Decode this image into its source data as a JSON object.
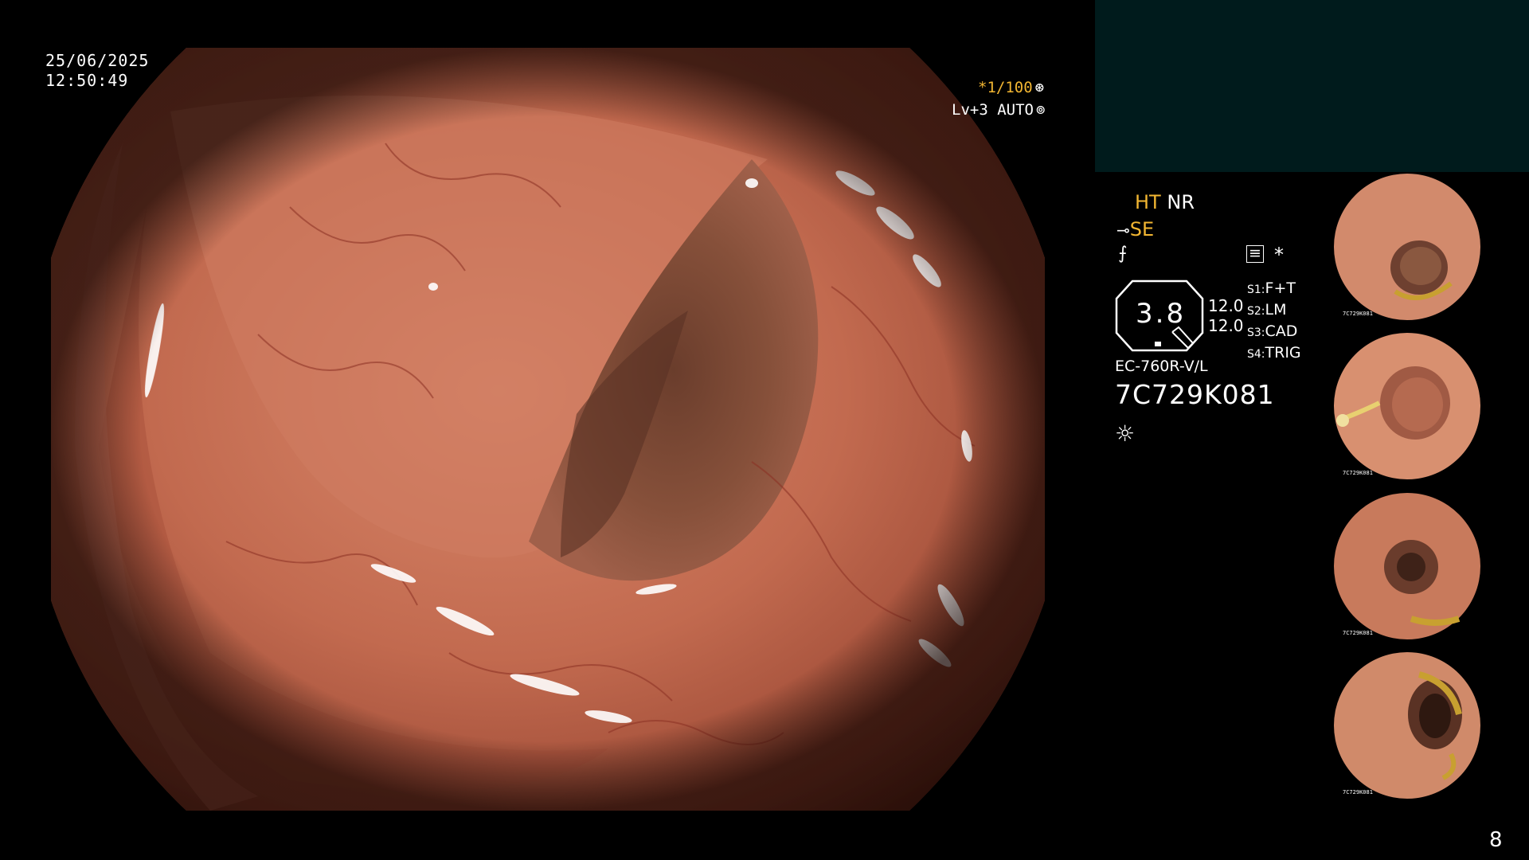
{
  "overlay": {
    "date": "25/06/2025",
    "time": "12:50:49",
    "shutter": "*1/100",
    "shutter_icon": "aperture-icon",
    "level": "Lv+3 AUTO",
    "level_icon": "brightness-ring-icon"
  },
  "info": {
    "ht": "HT",
    "nr": "NR",
    "se": "SE",
    "magnification": "3.8",
    "value_a": "12.0",
    "value_b": "12.0",
    "settings": [
      {
        "key": "S1:",
        "value": "F+T"
      },
      {
        "key": "S2:",
        "value": "LM"
      },
      {
        "key": "S3:",
        "value": "CAD"
      },
      {
        "key": "S4:",
        "value": "TRIG"
      }
    ],
    "model": "EC-760R-V/L",
    "serial": "7C729K081",
    "star": "*"
  },
  "thumbnails": [
    {
      "name": "capture-1",
      "label": "7C729K081"
    },
    {
      "name": "capture-2",
      "label": "7C729K081"
    },
    {
      "name": "capture-3",
      "label": "7C729K081"
    },
    {
      "name": "capture-4",
      "label": "7C729K081"
    }
  ],
  "page_number": "8",
  "colors": {
    "accent": "#f2b632",
    "panel_teal": "#001b1c",
    "mucosa": "#c8735a"
  }
}
